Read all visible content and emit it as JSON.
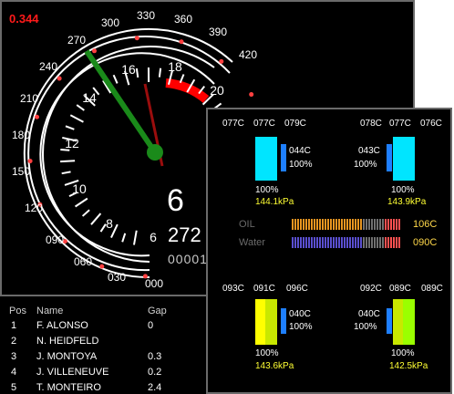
{
  "dash": {
    "lap_delta": "0.344",
    "gear": "6",
    "speed": "272",
    "odometer": "00001",
    "rpm_labels": [
      "000",
      "030",
      "060",
      "090",
      "120",
      "150",
      "180",
      "210",
      "240",
      "270",
      "300",
      "330",
      "360",
      "390",
      "420"
    ],
    "inner_labels": [
      "6",
      "8",
      "10",
      "12",
      "14",
      "16",
      "18",
      "20"
    ],
    "redline_color": "#ff0000",
    "needle_color_outer": "#1a8a1a",
    "needle_color_inner": "#a01010"
  },
  "standings": {
    "headers": {
      "pos": "Pos",
      "name": "Name",
      "gap": "Gap"
    },
    "rows": [
      {
        "pos": "1",
        "name": "F. ALONSO",
        "gap": "0"
      },
      {
        "pos": "2",
        "name": "N. HEIDFELD",
        "gap": ""
      },
      {
        "pos": "3",
        "name": "J. MONTOYA",
        "gap": "0.3"
      },
      {
        "pos": "4",
        "name": "J. VILLENEUVE",
        "gap": "0.2"
      },
      {
        "pos": "5",
        "name": "T. MONTEIRO",
        "gap": "2.4"
      }
    ]
  },
  "tyres": {
    "fl": {
      "temps": [
        "077C",
        "077C",
        "079C"
      ],
      "brake_temp": "044C",
      "wear": "100%",
      "wear_bottom": "100%",
      "pressure": "144.1kPa",
      "color": "#00e5ff"
    },
    "fr": {
      "temps": [
        "078C",
        "077C",
        "076C"
      ],
      "brake_temp": "043C",
      "wear": "100%",
      "wear_bottom": "100%",
      "pressure": "143.9kPa",
      "color": "#00e5ff"
    },
    "rl": {
      "temps": [
        "093C",
        "091C",
        "096C"
      ],
      "brake_temp": "040C",
      "wear": "100%",
      "wear_bottom": "100%",
      "pressure": "143.6kPa",
      "color": "#ffff00"
    },
    "rr": {
      "temps": [
        "092C",
        "089C",
        "089C"
      ],
      "brake_temp": "040C",
      "wear": "100%",
      "wear_bottom": "100%",
      "pressure": "142.5kPa",
      "color": "#aaff00"
    }
  },
  "fluids": {
    "oil_label": "OIL",
    "oil_value": "106C",
    "water_label": "Water",
    "water_value": "090C"
  }
}
